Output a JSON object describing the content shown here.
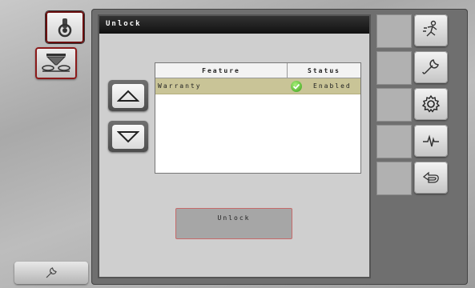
{
  "screen": {
    "title": "Unlock"
  },
  "left_nav": {
    "items": [
      {
        "name": "ignition-icon"
      },
      {
        "name": "spreader-icon"
      }
    ],
    "bottom": {
      "name": "wrench-icon"
    }
  },
  "table": {
    "headers": {
      "feature": "Feature",
      "status": "Status"
    },
    "rows": [
      {
        "feature": "Warranty",
        "status": "Enabled",
        "status_icon": "check-circle-icon",
        "selected": true
      }
    ]
  },
  "actions": {
    "unlock_label": "Unlock"
  },
  "scroll": {
    "up": "arrow-up-icon",
    "down": "arrow-down-icon"
  },
  "right_toolbar": {
    "buttons": [
      {
        "name": "running-person-icon"
      },
      {
        "name": "wrench-icon"
      },
      {
        "name": "gear-icon"
      },
      {
        "name": "diagnostics-icon"
      },
      {
        "name": "back-icon"
      }
    ]
  },
  "colors": {
    "selected_row": "#c9c497",
    "titlebar": "#111111",
    "accent_border": "#8b1a1a"
  }
}
